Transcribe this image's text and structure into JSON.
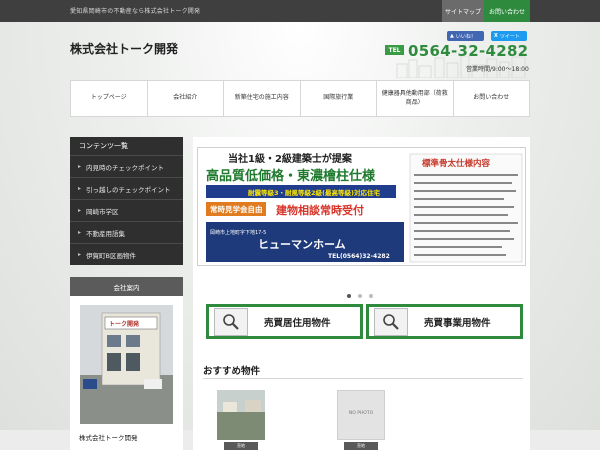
{
  "topbar": {
    "tagline": "愛知県岡崎市の不動産なら株式会社トーク開発",
    "sitemap_label": "サイトマップ",
    "contact_label": "お問い合わせ"
  },
  "header": {
    "logo": "株式会社トーク開発",
    "fb_like": "いいね！",
    "tweet": "ツイート",
    "tel_label": "TEL",
    "tel_number": "0564-32-4282",
    "hours": "営業時間/9:00～18:00"
  },
  "nav": {
    "items": [
      {
        "label": "トップページ"
      },
      {
        "label": "会社紹介"
      },
      {
        "label": "新築住宅の施工内容"
      },
      {
        "label": "国際旅行業"
      },
      {
        "label": "健康器具他動用部（荷救商品）"
      },
      {
        "label": "お問い合わせ"
      }
    ]
  },
  "sidebar": {
    "heading": "コンテンツ一覧",
    "items": [
      {
        "label": "内見時のチェックポイント"
      },
      {
        "label": "引っ越しのチェックポイント"
      },
      {
        "label": "岡崎市学区"
      },
      {
        "label": "不動産用語集"
      },
      {
        "label": "伊賀町B区画物件"
      }
    ],
    "company_heading": "会社案内",
    "company_name": "株式会社トーク開発",
    "photo_sign": "トーク開発"
  },
  "banner": {
    "headline": "当社1級・2級建築士が提案",
    "headline_main": "高品質低価格・東濃檜柱仕様",
    "sub": "耐震等級3・耐風等級2級(最高等級)対応住宅",
    "open_house": "常時見学会自由",
    "consult": "建物相談常時受付",
    "company_banner": "ヒューマンホーム",
    "banner_address": "岡崎市上地町字下地17-5",
    "banner_tel": "TEL(0564)32-4282",
    "spec_title": "標準骨太仕様内容"
  },
  "slider": {
    "dots": 3,
    "active": 0
  },
  "property_buttons": [
    {
      "label": "売買居住用物件",
      "icon": "magnifier-icon"
    },
    {
      "label": "売買事業用物件",
      "icon": "magnifier-icon"
    }
  ],
  "recommended": {
    "title": "おすすめ物件",
    "thumbs": [
      {
        "placeholder": "",
        "tag": "売地"
      },
      {
        "placeholder": "NO PHOTO",
        "tag": "売地"
      }
    ]
  },
  "colors": {
    "accent_green": "#2e8b3e",
    "topbar": "#3f3f3f",
    "sidebar": "#2f2f2f"
  }
}
